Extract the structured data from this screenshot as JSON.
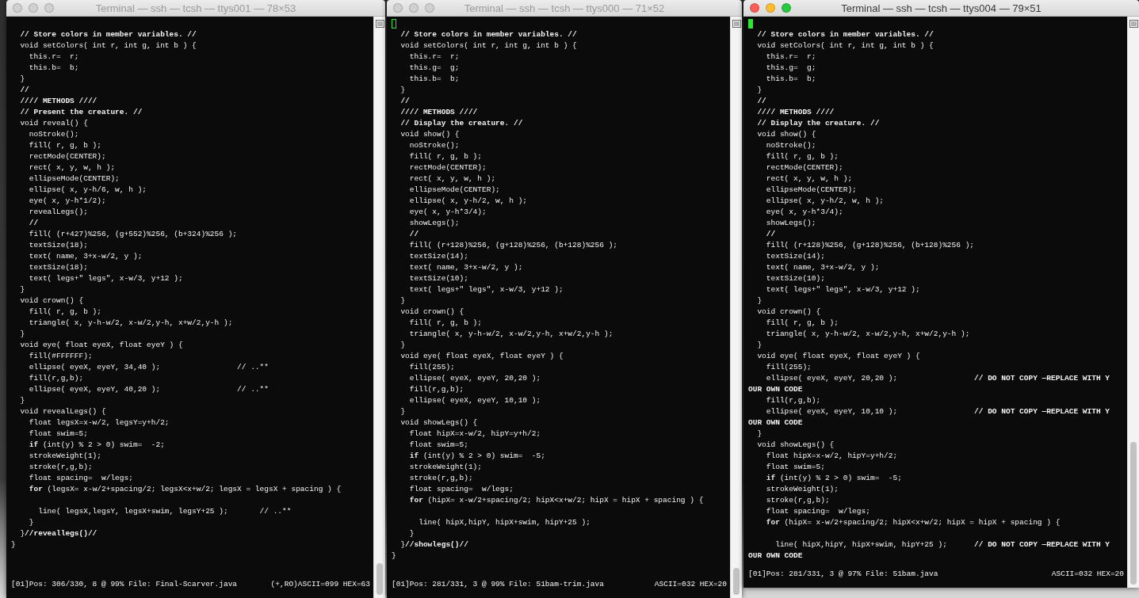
{
  "terminals": [
    {
      "title": "Terminal — ssh — tcsh — ttys001 — 78×53",
      "active": false,
      "lines": [
        {
          "kind": "blank"
        },
        {
          "kind": "comment",
          "text": "  // Store colors in member variables. //"
        },
        "  void setColors( int r, int g, int b ) {",
        "    this.r=  r;",
        "    this.b=  b;",
        "  }",
        {
          "kind": "comment",
          "text": "  //"
        },
        {
          "kind": "comment",
          "text": "  //// METHODS ////"
        },
        {
          "kind": "comment",
          "text": "  // Present the creature. //"
        },
        "  void reveal() {",
        "    noStroke();",
        "    fill( r, g, b );",
        "    rectMode(CENTER);",
        "    rect( x, y, w, h );",
        "    ellipseMode(CENTER);",
        "    ellipse( x, y-h/6, w, h );",
        "    eye( x, y-h*1/2);",
        "    revealLegs();",
        {
          "kind": "comment",
          "text": "    //"
        },
        "    fill( (r+427)%256, (g+552)%256, (b+324)%256 );",
        "    textSize(18);",
        "    text( name, 3+x-w/2, y );",
        "    textSize(18);",
        "    text( legs+\" legs\", x-w/3, y+12 );",
        "  }",
        "  void crown() {",
        "    fill( r, g, b );",
        "    triangle( x, y-h-w/2, x-w/2,y-h, x+w/2,y-h );",
        "  }",
        "  void eye( float eyeX, float eyeY ) {",
        "    fill(#FFFFFF);",
        "    ellipse( eyeX, eyeY, 34,40 );                 // ..**",
        "    fill(r,g,b);",
        "    ellipse( eyeX, eyeY, 40,20 );                 // ..**",
        "  }",
        "  void revealLegs() {",
        "    float legsX=x-w/2, legsY=y+h/2;",
        "    float swim=5;",
        "    **if** (int(y) % 2 > 0) swim=  -2;",
        "    strokeWeight(1);",
        "    stroke(r,g,b);",
        "    float spacing=  w/legs;",
        "    **for** (legsX= x-w/2+spacing/2; legsX<x+w/2; legsX = legsX + spacing ) {",
        {
          "kind": "blank"
        },
        "      line( legsX,legsY, legsX+swim, legsY+25 );       // ..**",
        "    }",
        "  }**//reveallegs()//**",
        "}"
      ],
      "status": "[01]Pos: 306/330, 8 @ 99% File: Final-Scarver.java",
      "status_right": "(+,RO)ASCII=099 HEX=63"
    },
    {
      "title": "Terminal — ssh — tcsh — ttys000 — 71×52",
      "active": false,
      "cursor": {
        "filled": false
      },
      "lines": [
        {
          "kind": "comment",
          "text": "  // Store colors in member variables. //"
        },
        "  void setColors( int r, int g, int b ) {",
        "    this.r=  r;",
        "    this.g=  g;",
        "    this.b=  b;",
        "  }",
        {
          "kind": "comment",
          "text": "  //"
        },
        {
          "kind": "comment",
          "text": "  //// METHODS ////"
        },
        {
          "kind": "comment",
          "text": "  // Display the creature. //"
        },
        "  void show() {",
        "    noStroke();",
        "    fill( r, g, b );",
        "    rectMode(CENTER);",
        "    rect( x, y, w, h );",
        "    ellipseMode(CENTER);",
        "    ellipse( x, y-h/2, w, h );",
        "    eye( x, y-h*3/4);",
        "    showLegs();",
        {
          "kind": "comment",
          "text": "    //"
        },
        "    fill( (r+128)%256, (g+128)%256, (b+128)%256 );",
        "    textSize(14);",
        "    text( name, 3+x-w/2, y );",
        "    textSize(10);",
        "    text( legs+\" legs\", x-w/3, y+12 );",
        "  }",
        "  void crown() {",
        "    fill( r, g, b );",
        "    triangle( x, y-h-w/2, x-w/2,y-h, x+w/2,y-h );",
        "  }",
        "  void eye( float eyeX, float eyeY ) {",
        "    fill(255);",
        "    ellipse( eyeX, eyeY, 20,20 );",
        "    fill(r,g,b);",
        "    ellipse( eyeX, eyeY, 10,10 );",
        "  }",
        "  void showLegs() {",
        "    float hipX=x-w/2, hipY=y+h/2;",
        "    float swim=5;",
        "    **if** (int(y) % 2 > 0) swim=  -5;",
        "    strokeWeight(1);",
        "    stroke(r,g,b);",
        "    float spacing=  w/legs;",
        "    **for** (hipX= x-w/2+spacing/2; hipX<x+w/2; hipX = hipX + spacing ) {",
        {
          "kind": "blank"
        },
        "      line( hipX,hipY, hipX+swim, hipY+25 );",
        "    }",
        "  }**//showlegs()//**",
        "}"
      ],
      "status": "[01]Pos: 281/331, 3 @ 99% File: 51bam-trim.java",
      "status_right": "ASCII=032 HEX=20"
    },
    {
      "title": "Terminal — ssh — tcsh — ttys004 — 79×51",
      "active": true,
      "cursor": {
        "filled": true
      },
      "lines": [
        {
          "kind": "comment",
          "text": "  // Store colors in member variables. //"
        },
        "  void setColors( int r, int g, int b ) {",
        "    this.r=  r;",
        "    this.g=  g;",
        "    this.b=  b;",
        "  }",
        {
          "kind": "comment",
          "text": "  //"
        },
        {
          "kind": "comment",
          "text": "  //// METHODS ////"
        },
        {
          "kind": "comment",
          "text": "  // Display the creature. //"
        },
        "  void show() {",
        "    noStroke();",
        "    fill( r, g, b );",
        "    rectMode(CENTER);",
        "    rect( x, y, w, h );",
        "    ellipseMode(CENTER);",
        "    ellipse( x, y-h/2, w, h );",
        "    eye( x, y-h*3/4);",
        "    showLegs();",
        {
          "kind": "comment",
          "text": "    //"
        },
        "    fill( (r+128)%256, (g+128)%256, (b+128)%256 );",
        "    textSize(14);",
        "    text( name, 3+x-w/2, y );",
        "    textSize(10);",
        "    text( legs+\" legs\", x-w/3, y+12 );",
        "  }",
        "  void crown() {",
        "    fill( r, g, b );",
        "    triangle( x, y-h-w/2, x-w/2,y-h, x+w/2,y-h );",
        "  }",
        "  void eye( float eyeX, float eyeY ) {",
        "    fill(255);",
        "    ellipse( eyeX, eyeY, 20,20 );                 **// DO NOT COPY —REPLACE WITH Y**",
        {
          "kind": "comment",
          "text": "OUR OWN CODE"
        },
        "    fill(r,g,b);",
        "    ellipse( eyeX, eyeY, 10,10 );                 **// DO NOT COPY —REPLACE WITH Y**",
        {
          "kind": "comment",
          "text": "OUR OWN CODE"
        },
        "  }",
        "  void showLegs() {",
        "    float hipX=x-w/2, hipY=y+h/2;",
        "    float swim=5;",
        "    **if** (int(y) % 2 > 0) swim=  -5;",
        "    strokeWeight(1);",
        "    stroke(r,g,b);",
        "    float spacing=  w/legs;",
        "    **for** (hipX= x-w/2+spacing/2; hipX<x+w/2; hipX = hipX + spacing ) {",
        {
          "kind": "blank"
        },
        "      line( hipX,hipY, hipX+swim, hipY+25 );      **// DO NOT COPY —REPLACE WITH Y**",
        {
          "kind": "comment",
          "text": "OUR OWN CODE"
        }
      ],
      "status": "[01]Pos: 281/331, 3 @ 97% File: 51bam.java",
      "status_right": "ASCII=032 HEX=20"
    }
  ]
}
